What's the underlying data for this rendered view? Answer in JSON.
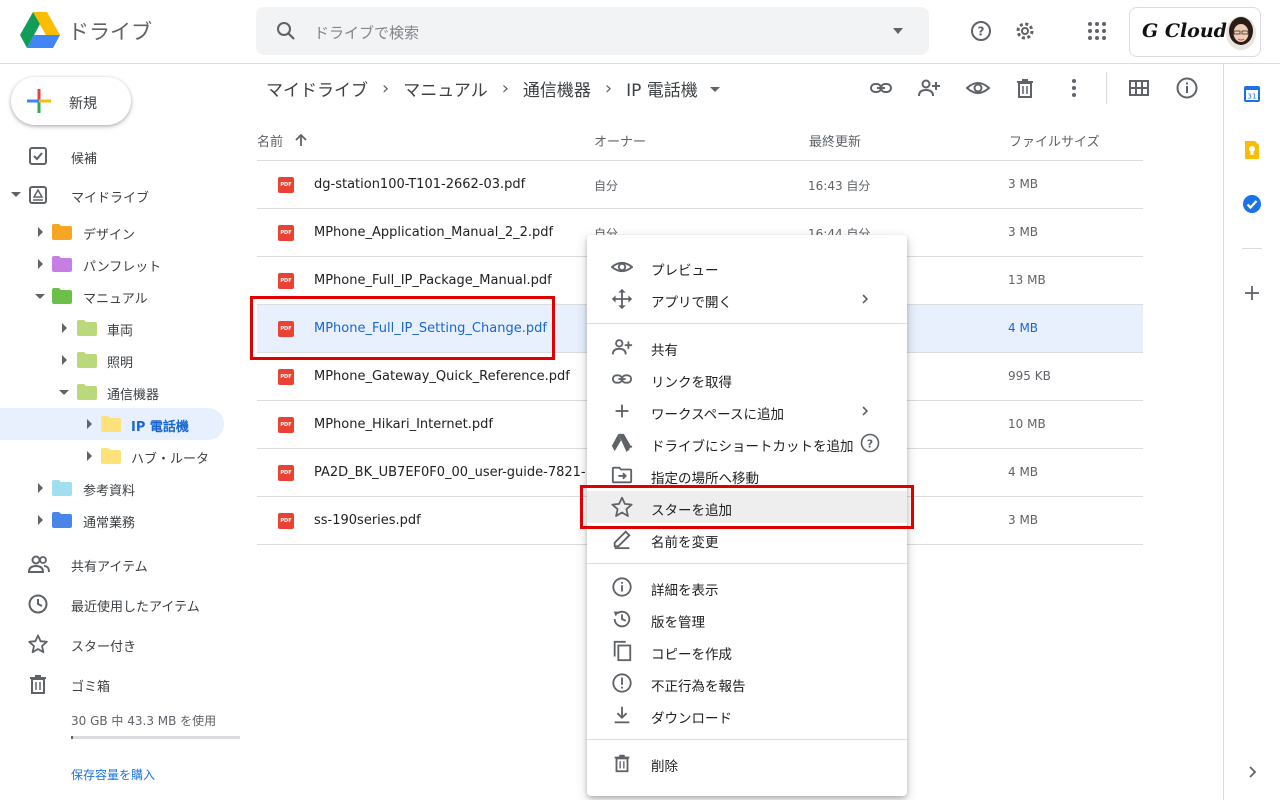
{
  "app": {
    "title": "ドライブ"
  },
  "search": {
    "placeholder": "ドライブで検索"
  },
  "account": {
    "brand": "G Cloud"
  },
  "sidebar": {
    "new_label": "新規",
    "items": [
      {
        "label": "候補",
        "icon": "priority-icon"
      },
      {
        "label": "マイドライブ",
        "icon": "my-drive-icon"
      }
    ],
    "tree": [
      {
        "label": "デザイン",
        "color": "#f6a623"
      },
      {
        "label": "パンフレット",
        "color": "#c77ee2"
      },
      {
        "label": "マニュアル",
        "color": "#6cc04a"
      },
      {
        "label": "車両",
        "color": "#b9d97a"
      },
      {
        "label": "照明",
        "color": "#b9d97a"
      },
      {
        "label": "通信機器",
        "color": "#b9d97a"
      },
      {
        "label": "IP 電話機",
        "color": "#fde27c"
      },
      {
        "label": "ハブ・ルータ",
        "color": "#fde27c"
      },
      {
        "label": "参考資料",
        "color": "#9fdff0"
      },
      {
        "label": "通常業務",
        "color": "#4a86e8"
      }
    ],
    "bottom_items": [
      {
        "label": "共有アイテム",
        "icon": "shared-icon"
      },
      {
        "label": "最近使用したアイテム",
        "icon": "recent-icon"
      },
      {
        "label": "スター付き",
        "icon": "star-icon"
      },
      {
        "label": "ゴミ箱",
        "icon": "trash-icon"
      }
    ],
    "storage_text": "30 GB 中 43.3 MB を使用",
    "storage_used_fraction": 0.0014,
    "buy_storage": "保存容量を購入"
  },
  "breadcrumb": [
    "マイドライブ",
    "マニュアル",
    "通信機器",
    "IP 電話機"
  ],
  "table": {
    "headers": {
      "name": "名前",
      "owner": "オーナー",
      "modified": "最終更新",
      "size": "ファイルサイズ"
    },
    "rows": [
      {
        "name": "dg-station100-T101-2662-03.pdf",
        "owner": "自分",
        "modified": "16:43 自分",
        "size": "3 MB"
      },
      {
        "name": "MPhone_Application_Manual_2_2.pdf",
        "owner": "自分",
        "modified": "16:44 自分",
        "size": "3 MB"
      },
      {
        "name": "MPhone_Full_IP_Package_Manual.pdf",
        "owner": "",
        "modified": "",
        "size": "13 MB"
      },
      {
        "name": "MPhone_Full_IP_Setting_Change.pdf",
        "owner": "",
        "modified": "",
        "size": "4 MB"
      },
      {
        "name": "MPhone_Gateway_Quick_Reference.pdf",
        "owner": "",
        "modified": "",
        "size": "995 KB"
      },
      {
        "name": "MPhone_Hikari_Internet.pdf",
        "owner": "",
        "modified": "",
        "size": "10 MB"
      },
      {
        "name": "PA2D_BK_UB7EF0F0_00_user-guide-7821-...",
        "owner": "",
        "modified": "",
        "size": "4 MB"
      },
      {
        "name": "ss-190series.pdf",
        "owner": "",
        "modified": "",
        "size": "3 MB"
      }
    ],
    "file_badge": "PDF"
  },
  "context_menu": {
    "items": [
      {
        "label": "プレビュー",
        "icon": "eye-icon"
      },
      {
        "label": "アプリで開く",
        "icon": "open-with-icon"
      },
      {
        "label": "共有",
        "icon": "person-add-icon"
      },
      {
        "label": "リンクを取得",
        "icon": "link-icon"
      },
      {
        "label": "ワークスペースに追加",
        "icon": "plus-icon"
      },
      {
        "label": "ドライブにショートカットを追加",
        "icon": "drive-shortcut-icon"
      },
      {
        "label": "指定の場所へ移動",
        "icon": "move-icon"
      },
      {
        "label": "スターを追加",
        "icon": "star-outline-icon"
      },
      {
        "label": "名前を変更",
        "icon": "pencil-icon"
      },
      {
        "label": "詳細を表示",
        "icon": "info-icon"
      },
      {
        "label": "版を管理",
        "icon": "history-icon"
      },
      {
        "label": "コピーを作成",
        "icon": "copy-icon"
      },
      {
        "label": "不正行為を報告",
        "icon": "report-icon"
      },
      {
        "label": "ダウンロード",
        "icon": "download-icon"
      },
      {
        "label": "削除",
        "icon": "trash-icon"
      }
    ]
  },
  "colors": {
    "accent": "#1a73e8",
    "selected_bg": "#e8f0fe",
    "highlight_box": "#e00000",
    "pdf_red": "#ea4335"
  }
}
